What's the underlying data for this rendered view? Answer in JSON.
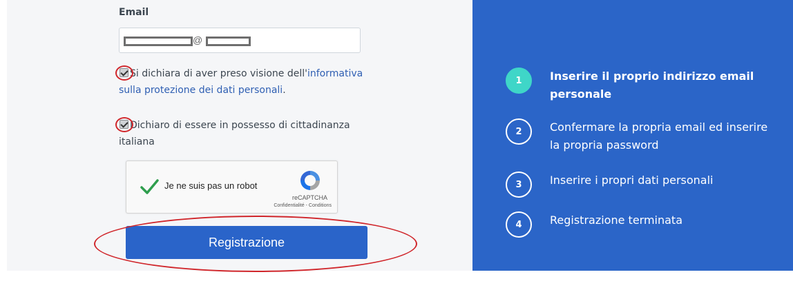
{
  "form": {
    "email_label": "Email",
    "email_at": "@",
    "check1": {
      "text_before": "Si dichiara di aver preso visione dell'",
      "link_text": "informativa sulla protezione dei dati personali",
      "text_after": "."
    },
    "check2": {
      "text": "Dichiaro di essere in possesso di cittadinanza italiana"
    },
    "captcha": {
      "label": "Je ne suis pas un robot",
      "brand": "reCAPTCHA",
      "links": "Confidentialité - Conditions"
    },
    "submit_label": "Registrazione"
  },
  "steps": [
    {
      "number": "1",
      "label": "Inserire il proprio indirizzo email personale"
    },
    {
      "number": "2",
      "label": "Confermare la propria email ed inserire la propria password"
    },
    {
      "number": "3",
      "label": "Inserire i propri dati personali"
    },
    {
      "number": "4",
      "label": "Registrazione terminata"
    }
  ],
  "colors": {
    "primary_blue": "#2b65c8",
    "button_blue": "#2a64c9",
    "active_step": "#3fd6c8",
    "annotation_red": "#d0262b"
  }
}
